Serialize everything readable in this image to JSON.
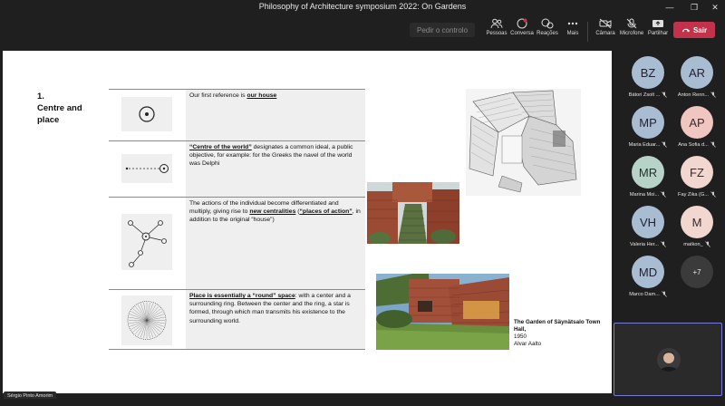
{
  "window": {
    "title": "Philosophy of Architecture symposium 2022: On Gardens"
  },
  "toolbar": {
    "raise_hand_placeholder": "Pedir o controlo",
    "people": "Pessoas",
    "chat": "Conversa",
    "reactions": "Reações",
    "more": "Mais",
    "camera": "Câmara",
    "mic": "Microfone",
    "share": "Partilhar",
    "leave": "Sair"
  },
  "slide": {
    "heading": "1.\nCentre and\nplace",
    "rows": [
      {
        "pre": "Our first reference is ",
        "emph": "our house",
        "post": ""
      },
      {
        "emph": "“Centre of the world”",
        "post": " designates a common ideal, a public objective, for example: for the Greeks the navel of the world was Delphi"
      },
      {
        "pre": "The actions of the individual become differentiated and multiply, giving rise to ",
        "emph": "new centralities",
        "mid": " (",
        "emph2": "“places of action”",
        "post": ", in addition to the original “house”)"
      },
      {
        "emph": "Place is essentially a “round” space",
        "post": ": with a center and a surrounding ring. Between the center and the ring, a star is formed, through which man transmits his existence to the surrounding world."
      }
    ],
    "caption_title": "The Garden of Säynätsalo Town Hall,",
    "caption_year": "1950",
    "caption_author": "Alvar Aalto"
  },
  "presenter": {
    "name": "Sérgio Pinto Amorim"
  },
  "participants": [
    {
      "initials": "BZ",
      "name": "Bátori Zsolt ...",
      "tone": "blue"
    },
    {
      "initials": "AR",
      "name": "Anton Renn...",
      "tone": "blue"
    },
    {
      "initials": "MP",
      "name": "Maria Eduar...",
      "tone": "blue"
    },
    {
      "initials": "AP",
      "name": "Ana Sofia d...",
      "tone": "peach"
    },
    {
      "initials": "MR",
      "name": "Marina Moi...",
      "tone": "green"
    },
    {
      "initials": "FZ",
      "name": "Fay Zika (G...",
      "tone": "peach2"
    },
    {
      "initials": "VH",
      "name": "Valeria Her...",
      "tone": "blue"
    },
    {
      "initials": "M",
      "name": "matkon_",
      "tone": "peach2"
    },
    {
      "initials": "MD",
      "name": "Marco Dam...",
      "tone": "blue"
    },
    {
      "initials": "+7",
      "name": "",
      "tone": "more"
    }
  ]
}
